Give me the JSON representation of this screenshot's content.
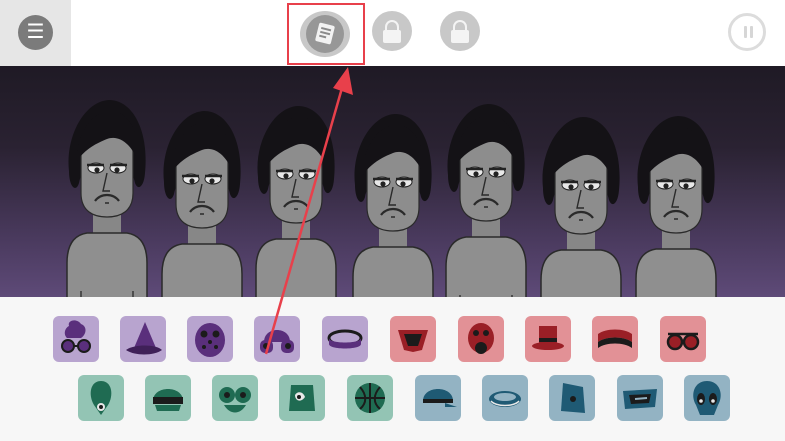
{
  "top_bar": {
    "menu_icon": "hamburger-menu-icon",
    "mode_button_icon": "document-icon",
    "locked_buttons": [
      "lock-icon",
      "lock-icon"
    ],
    "pause_icon": "pause-icon"
  },
  "stage": {
    "character_count": 7
  },
  "palette": {
    "beats": [
      "purple",
      "purple",
      "purple",
      "purple",
      "purple"
    ],
    "effects": [
      "red",
      "red",
      "red",
      "red",
      "red"
    ],
    "melodies": [
      "green",
      "green",
      "green",
      "green",
      "green"
    ],
    "voices": [
      "blue",
      "blue",
      "blue",
      "blue",
      "blue"
    ]
  },
  "colors": {
    "highlight_frame": "#e8404b",
    "arrow": "#e8404b",
    "beats_tile": "#b8a4cf",
    "effects_tile": "#e29196",
    "melodies_tile": "#93c4b4",
    "voices_tile": "#93b3c3"
  }
}
